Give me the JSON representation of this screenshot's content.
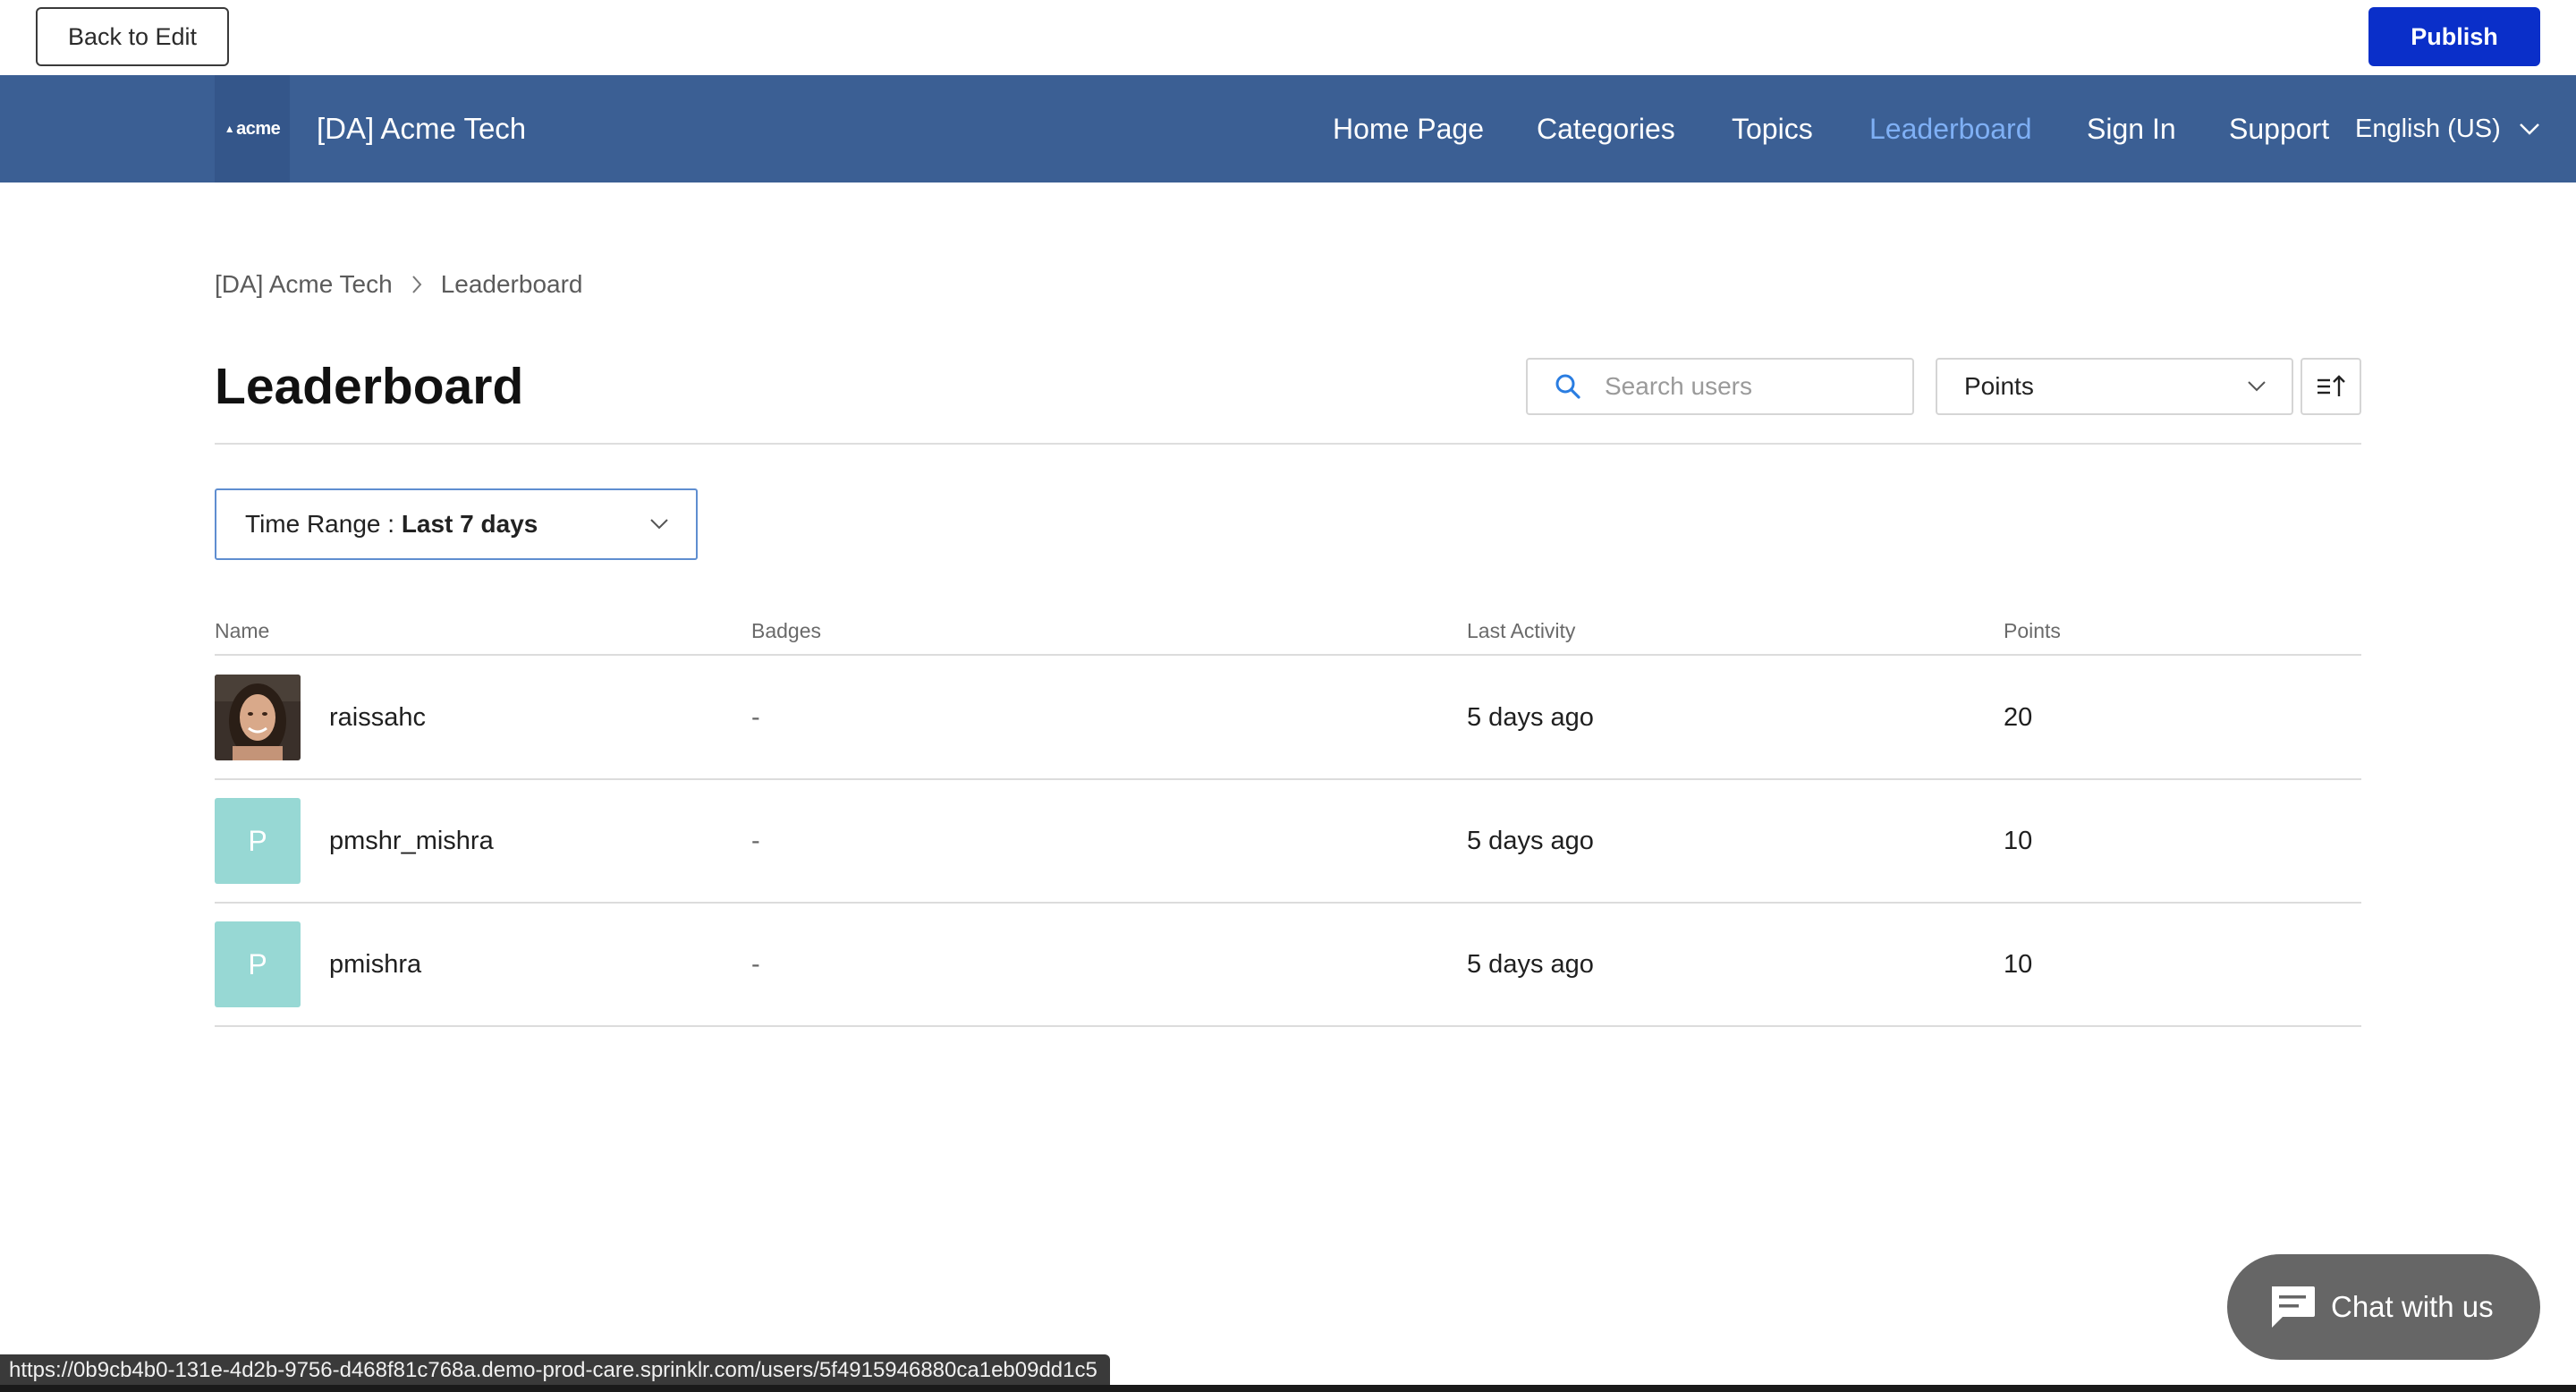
{
  "editor": {
    "back_label": "Back to Edit",
    "publish_label": "Publish"
  },
  "header": {
    "logo_text": "acme",
    "site_name": "[DA] Acme Tech",
    "nav": [
      {
        "label": "Home Page",
        "active": false
      },
      {
        "label": "Categories",
        "active": false
      },
      {
        "label": "Topics",
        "active": false
      },
      {
        "label": "Leaderboard",
        "active": true
      },
      {
        "label": "Sign In",
        "active": false
      },
      {
        "label": "Support",
        "active": false
      }
    ],
    "language": "English (US)"
  },
  "breadcrumb": {
    "items": [
      "[DA] Acme Tech",
      "Leaderboard"
    ]
  },
  "page": {
    "title": "Leaderboard",
    "search_placeholder": "Search users",
    "sort_value": "Points",
    "time_range_label": "Time Range : ",
    "time_range_value": "Last 7 days"
  },
  "table": {
    "columns": [
      "Name",
      "Badges",
      "Last Activity",
      "Points"
    ],
    "rows": [
      {
        "name": "raissahc",
        "avatar": "photo",
        "badges": "-",
        "last_activity": "5 days ago",
        "points": "20"
      },
      {
        "name": "pmshr_mishra",
        "avatar": "P",
        "badges": "-",
        "last_activity": "5 days ago",
        "points": "10"
      },
      {
        "name": "pmishra",
        "avatar": "P",
        "badges": "-",
        "last_activity": "5 days ago",
        "points": "10"
      }
    ]
  },
  "chat": {
    "label": "Chat with us"
  },
  "status_bar": {
    "url": "https://0b9cb4b0-131e-4d2b-9756-d468f81c768a.demo-prod-care.sprinklr.com/users/5f4915946880ca1eb09dd1c5"
  },
  "colors": {
    "header_bg": "#3b5f94",
    "publish_bg": "#0a2fc9",
    "nav_active": "#7fb0f5",
    "avatar_letter_bg": "#97d8d4"
  }
}
